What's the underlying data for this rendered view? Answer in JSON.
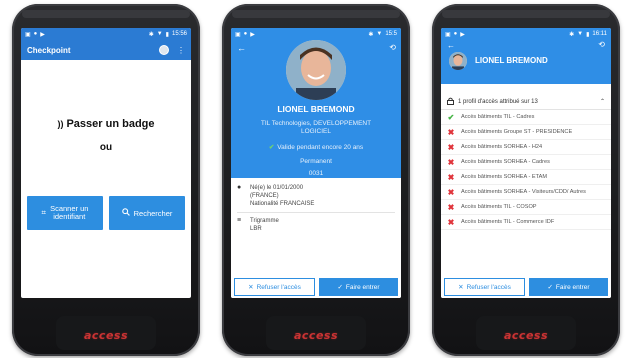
{
  "brand_text": "access",
  "phone1": {
    "status_time": "15:56",
    "app_title": "Checkpoint",
    "badge_prompt": "Passer un badge",
    "or_text": "ou",
    "scan_label_1": "Scanner un",
    "scan_label_2": "identifiant",
    "search_label": "Rechercher",
    "icons": [
      "nfc-icon",
      "avatar-icon",
      "more-icon",
      "qr-scan-icon",
      "search-icon"
    ]
  },
  "phone2": {
    "status_time": "15:5",
    "name": "LIONEL BREMOND",
    "company_line_1": "TIL Technologies, DEVELOPPEMENT",
    "company_line_2": "LOGICIEL",
    "validity": "Valide pendant encore 20 ans",
    "status": "Permanent",
    "code": "0031",
    "birth_line_1": "Né(e) le 01/01/2000",
    "birth_line_2": "(FRANCE)",
    "nationality": "Nationalité FRANCAISE",
    "trigram_label": "Trigramme",
    "trigram_value": "LBR",
    "refuse_label": "Refuser l'accès",
    "enter_label": "Faire entrer"
  },
  "phone3": {
    "status_time": "16:11",
    "name": "LIONEL BREMOND",
    "profile_summary": "1 profil d'accès attribué sur 13",
    "access_items": [
      {
        "label": "Accès bâtiments TIL - Cadres",
        "status": "granted"
      },
      {
        "label": "Accès bâtiments Groupe ST - PRESIDENCE",
        "status": "denied"
      },
      {
        "label": "Accès bâtiments SORHEA - H24",
        "status": "denied"
      },
      {
        "label": "Accès bâtiments SORHEA - Cadres",
        "status": "denied"
      },
      {
        "label": "Accès bâtiments SORHEA - ETAM",
        "status": "denied"
      },
      {
        "label": "Accès bâtiments SORHEA - Visiteurs/CDD/ Autres",
        "status": "denied"
      },
      {
        "label": "Accès bâtiments TIL - COSOP",
        "status": "denied"
      },
      {
        "label": "Accès bâtiments TIL - Commerce IDF",
        "status": "denied"
      }
    ],
    "refuse_label": "Refuser l'accès",
    "enter_label": "Faire entrer"
  },
  "colors": {
    "primary": "#2b7bd3",
    "header_blue": "#2f8ee6",
    "button_blue": "#2d8ee0",
    "granted": "#43b343",
    "denied": "#e0333a",
    "brand_red": "#cc3333"
  }
}
